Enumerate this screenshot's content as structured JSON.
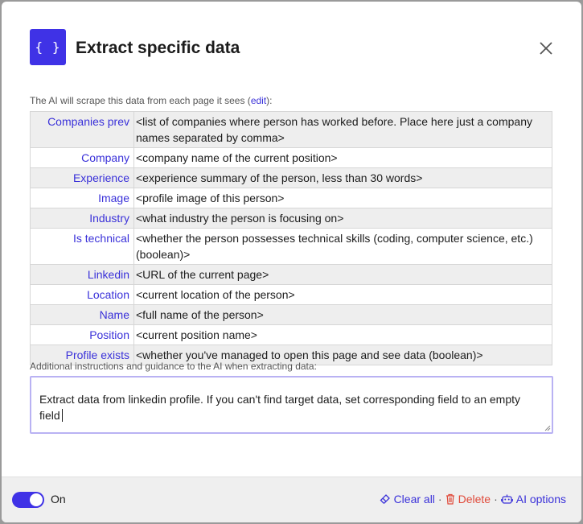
{
  "dialog": {
    "logo_text": "{ }",
    "title": "Extract specific data"
  },
  "intro": {
    "prefix": "The AI will scrape this data from each page it sees (",
    "edit_link": "edit",
    "suffix": "):"
  },
  "fields": [
    {
      "key": "Companies prev",
      "value": "<list of companies where person has worked before. Place here just a company names separated by comma>"
    },
    {
      "key": "Company",
      "value": "<company name of the current position>"
    },
    {
      "key": "Experience",
      "value": "<experience summary of the person, less than 30 words>"
    },
    {
      "key": "Image",
      "value": "<profile image of this person>"
    },
    {
      "key": "Industry",
      "value": "<what industry the person is focusing on>"
    },
    {
      "key": "Is technical",
      "value": "<whether the person possesses technical skills (coding, computer science, etc.) (boolean)>"
    },
    {
      "key": "Linkedin",
      "value": "<URL of the current page>"
    },
    {
      "key": "Location",
      "value": "<current location of the person>"
    },
    {
      "key": "Name",
      "value": "<full name of the person>"
    },
    {
      "key": "Position",
      "value": "<current position name>"
    },
    {
      "key": "Profile exists",
      "value": "<whether you've managed to open this page and see data (boolean)>"
    }
  ],
  "instructions": {
    "label": "Additional instructions and guidance to the AI when extracting data:",
    "value": "Extract data from linkedin profile. If you can't find target data, set corresponding field to an empty field"
  },
  "footer": {
    "toggle_label": "On",
    "toggle_on": true,
    "clear_all": "Clear all",
    "delete": "Delete",
    "ai_options": "AI options",
    "separator": "·"
  },
  "colors": {
    "accent": "#3f32e6",
    "link": "#3a31d9",
    "danger": "#e04a3a"
  }
}
